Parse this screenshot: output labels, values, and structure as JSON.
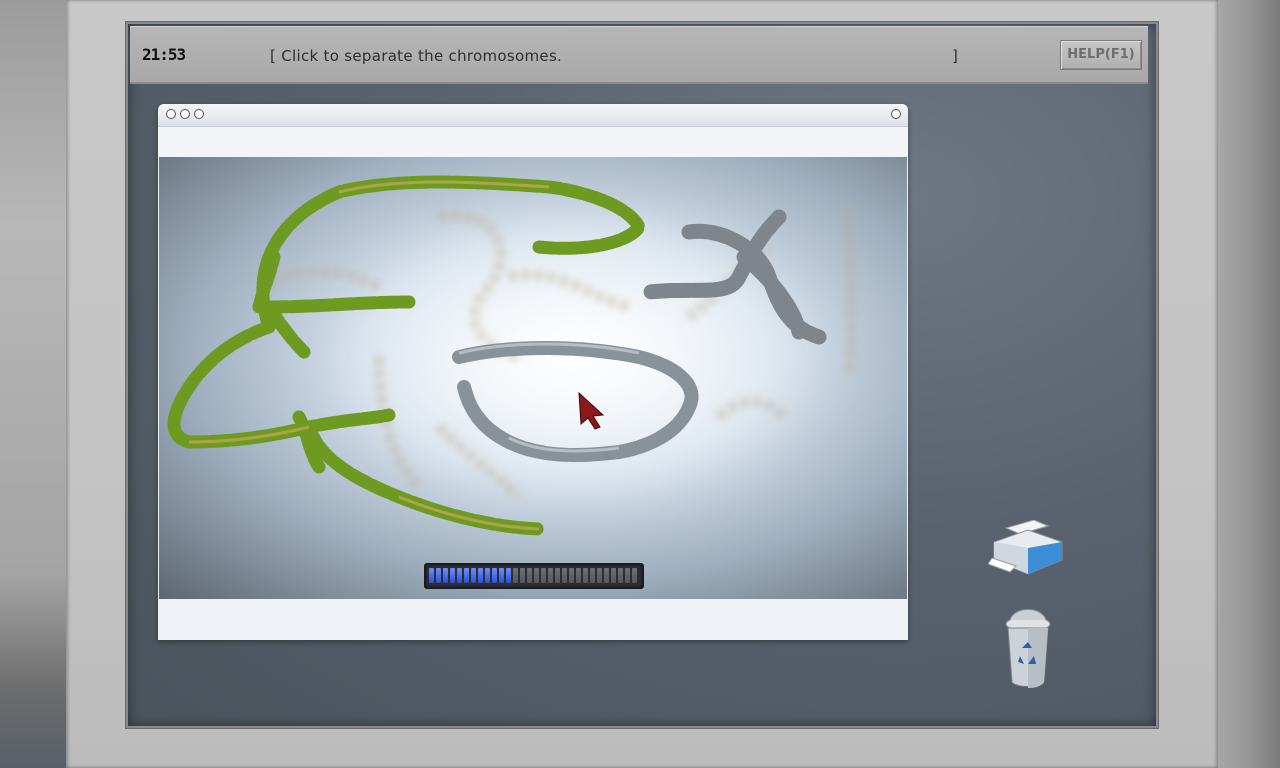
{
  "topbar": {
    "clock": "21:53",
    "instruction_open": "[ ",
    "instruction": "Click to separate the chromosomes.",
    "instruction_close": "]",
    "help_label": "HELP(F1)"
  },
  "progress": {
    "segments_filled": 12,
    "segments_total": 30,
    "fraction": 0.4
  },
  "icons": {
    "printer": "printer-icon",
    "recycle_bin": "recycle-bin-icon",
    "cursor": "arrow-cursor-icon"
  },
  "colors": {
    "progress_fill": "#2a4fd6",
    "progress_empty": "#55585d",
    "chromosome_green": "#7fae2c",
    "chromosome_gray": "#8e959c",
    "screen_bg": "#59626e"
  }
}
